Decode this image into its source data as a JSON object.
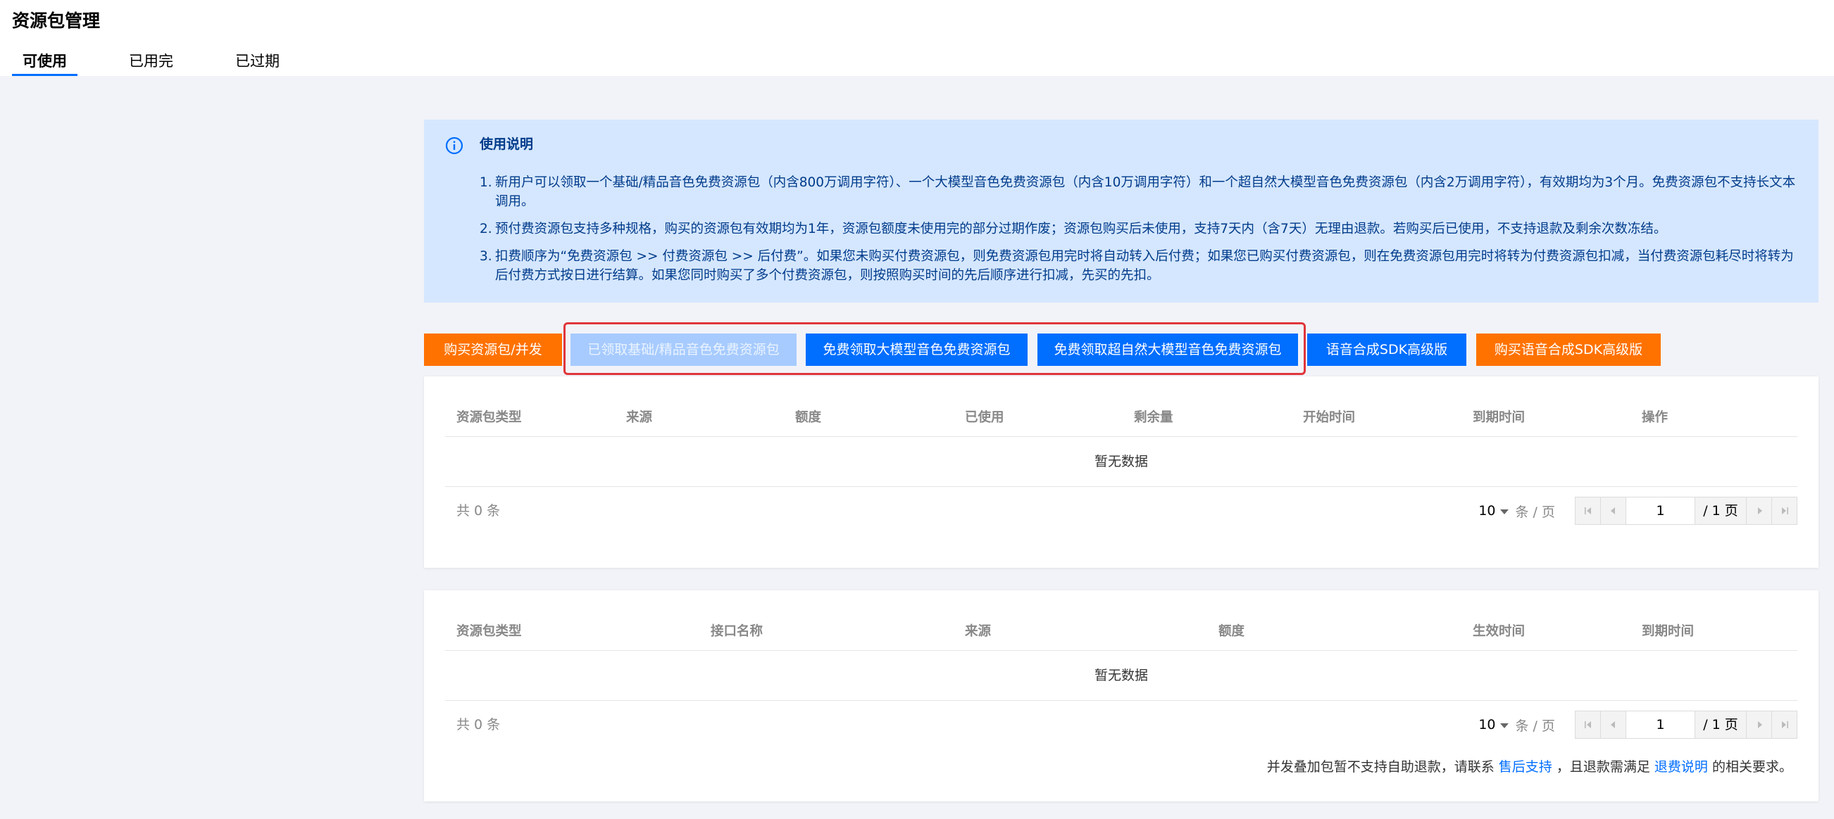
{
  "header": {
    "title": "资源包管理",
    "tabs": [
      {
        "label": "可使用",
        "active": true
      },
      {
        "label": "已用完",
        "active": false
      },
      {
        "label": "已过期",
        "active": false
      }
    ]
  },
  "notice": {
    "icon": "info-icon",
    "title": "使用说明",
    "items": [
      {
        "num": "1.",
        "text": "新用户可以领取一个基础/精品音色免费资源包（内含800万调用字符）、一个大模型音色免费资源包（内含10万调用字符）和一个超自然大模型音色免费资源包（内含2万调用字符），有效期均为3个月。免费资源包不支持长文本调用。"
      },
      {
        "num": "2.",
        "text": "预付费资源包支持多种规格，购买的资源包有效期均为1年，资源包额度未使用完的部分过期作废；资源包购买后未使用，支持7天内（含7天）无理由退款。若购买后已使用，不支持退款及剩余次数冻结。"
      },
      {
        "num": "3.",
        "text": "扣费顺序为“免费资源包 >> 付费资源包 >> 后付费”。如果您未购买付费资源包，则免费资源包用完时将自动转入后付费；如果您已购买付费资源包，则在免费资源包用完时将转为付费资源包扣减，当付费资源包耗尽时将转为后付费方式按日进行结算。如果您同时购买了多个付费资源包，则按照购买时间的先后顺序进行扣减，先买的先扣。"
      }
    ]
  },
  "buttons": {
    "buy_package": "购买资源包/并发",
    "claimed_basic": "已领取基础/精品音色免费资源包",
    "claim_llm": "免费领取大模型音色免费资源包",
    "claim_super_llm": "免费领取超自然大模型音色免费资源包",
    "sdk_advanced": "语音合成SDK高级版",
    "buy_sdk_advanced": "购买语音合成SDK高级版"
  },
  "table1": {
    "columns": [
      "资源包类型",
      "来源",
      "额度",
      "已使用",
      "剩余量",
      "开始时间",
      "到期时间",
      "操作"
    ],
    "empty_text": "暂无数据",
    "total_text": "共 0 条",
    "page_size": "10",
    "per_page_label": "条 / 页",
    "current_page": "1",
    "total_pages": "/ 1 页"
  },
  "table2": {
    "columns": [
      "资源包类型",
      "接口名称",
      "来源",
      "额度",
      "生效时间",
      "到期时间"
    ],
    "empty_text": "暂无数据",
    "total_text": "共 0 条",
    "page_size": "10",
    "per_page_label": "条 / 页",
    "current_page": "1",
    "total_pages": "/ 1 页"
  },
  "refund_note": {
    "prefix": "并发叠加包暂不支持自助退款，请联系",
    "link1": "售后支持",
    "middle": "，且退款需满足",
    "link2": "退费说明",
    "suffix": "的相关要求。"
  },
  "colors": {
    "brand_blue": "#006eff",
    "orange": "#ff7200",
    "disabled_blue": "#a7cbff",
    "notice_bg": "#d5e7ff",
    "highlight_red": "#e0363b"
  }
}
